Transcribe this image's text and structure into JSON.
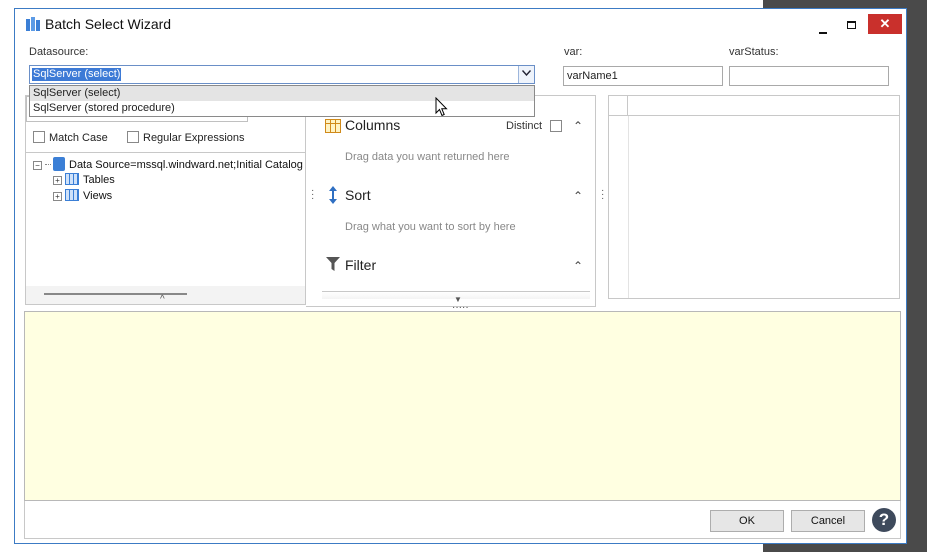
{
  "window": {
    "title": "Batch Select Wizard",
    "min_glyph": "",
    "max_glyph": "",
    "close_glyph": "✕"
  },
  "datasource": {
    "label": "Datasource:",
    "selected": "SqlServer (select)",
    "options": [
      "SqlServer (select)",
      "SqlServer (stored procedure)"
    ],
    "highlighted_index": 0
  },
  "var": {
    "label": "var:",
    "value": "varName1"
  },
  "varStatus": {
    "label": "varStatus:",
    "value": ""
  },
  "left_panel": {
    "match_case_label": "Match Case",
    "regex_label": "Regular Expressions",
    "tree": {
      "root": "Data Source=mssql.windward.net;Initial Catalog",
      "children": [
        "Tables",
        "Views"
      ]
    }
  },
  "middle_panel": {
    "columns": {
      "title": "Columns",
      "distinct_label": "Distinct",
      "hint": "Drag data you want returned here"
    },
    "sort": {
      "title": "Sort",
      "hint": "Drag what you want to sort by here"
    },
    "filter": {
      "title": "Filter"
    }
  },
  "buttons": {
    "ok": "OK",
    "cancel": "Cancel",
    "help": "?"
  },
  "colors": {
    "sql_area_bg": "#ffffe1",
    "accent": "#3d7ad6",
    "close_button": "#c9302c"
  }
}
